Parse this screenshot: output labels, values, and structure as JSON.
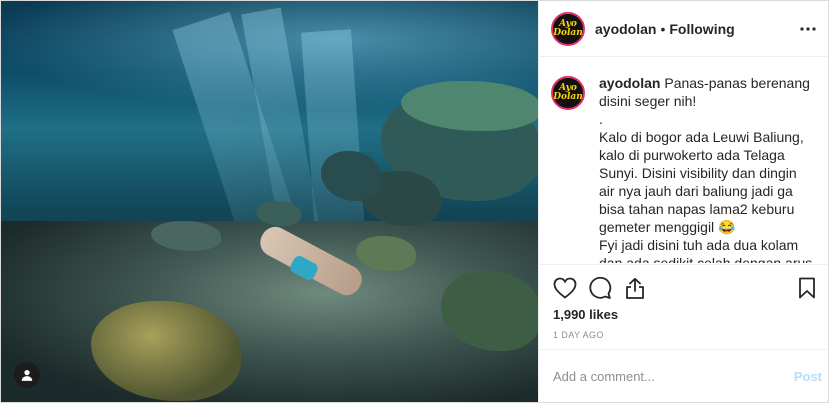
{
  "post": {
    "username": "ayodolan",
    "separator": "•",
    "follow_state": "Following",
    "avatar_text": "Ayo Dolan",
    "caption": {
      "username": "ayodolan",
      "line1": "Panas-panas berenang disini seger nih!",
      "line2": ".",
      "line3": "Kalo di bogor ada Leuwi Baliung, kalo di purwokerto ada Telaga Sunyi. Disini visibility dan dingin air nya jauh dari baliung jadi ga bisa tahan napas lama2 keburu gemeter menggigil 😂",
      "line4": "Fyi jadi disini tuh ada dua kolam dan ada sedikit celah dengan arus"
    },
    "likes": "1,990 likes",
    "timestamp": "1 DAY AGO",
    "comment_placeholder": "Add a comment...",
    "post_button": "Post"
  },
  "icons": {
    "like": "heart-icon",
    "comment": "comment-icon",
    "share": "share-icon",
    "save": "bookmark-icon",
    "more": "more-icon",
    "tag": "user-tag-icon"
  },
  "colors": {
    "avatar_ring": "#e1306c",
    "avatar_text": "#ffd400",
    "post_disabled": "#b2dffc",
    "meta_gray": "#8e8e8e"
  }
}
